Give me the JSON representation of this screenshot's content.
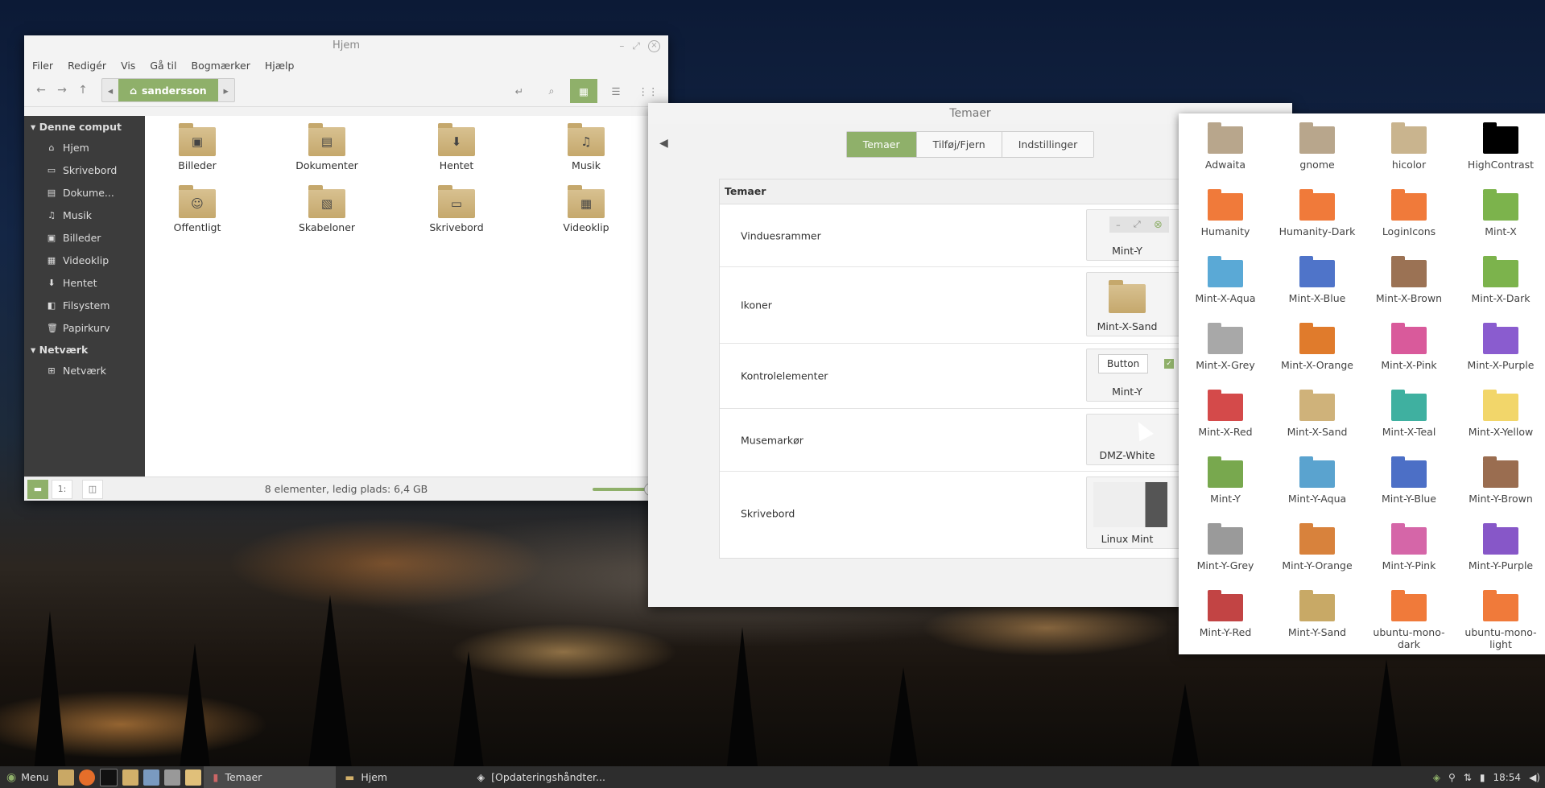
{
  "nemo": {
    "title": "Hjem",
    "menu": [
      "Filer",
      "Redigér",
      "Vis",
      "Gå til",
      "Bogmærker",
      "Hjælp"
    ],
    "breadcrumb": "sandersson",
    "sidebar": {
      "sections": [
        {
          "title": "Denne comput",
          "items": [
            {
              "label": "Hjem",
              "icon": "home-icon",
              "glyph": "⌂"
            },
            {
              "label": "Skrivebord",
              "icon": "desktop-icon",
              "glyph": "▭"
            },
            {
              "label": "Dokume...",
              "icon": "document-icon",
              "glyph": "▤"
            },
            {
              "label": "Musik",
              "icon": "music-icon",
              "glyph": "♫"
            },
            {
              "label": "Billeder",
              "icon": "pictures-icon",
              "glyph": "▣"
            },
            {
              "label": "Videoklip",
              "icon": "video-icon",
              "glyph": "▦"
            },
            {
              "label": "Hentet",
              "icon": "download-icon",
              "glyph": "⬇"
            },
            {
              "label": "Filsystem",
              "icon": "filesystem-icon",
              "glyph": "◧"
            },
            {
              "label": "Papirkurv",
              "icon": "trash-icon",
              "glyph": "🗑"
            }
          ]
        },
        {
          "title": "Netværk",
          "items": [
            {
              "label": "Netværk",
              "icon": "network-icon",
              "glyph": "⊞"
            }
          ]
        }
      ]
    },
    "files": [
      {
        "label": "Billeder",
        "glyph": "▣"
      },
      {
        "label": "Dokumenter",
        "glyph": "▤"
      },
      {
        "label": "Hentet",
        "glyph": "⬇"
      },
      {
        "label": "Musik",
        "glyph": "♫"
      },
      {
        "label": "Offentligt",
        "glyph": "☺"
      },
      {
        "label": "Skabeloner",
        "glyph": "▧"
      },
      {
        "label": "Skrivebord",
        "glyph": "▭"
      },
      {
        "label": "Videoklip",
        "glyph": "▦"
      }
    ],
    "status": "8 elementer, ledig plads: 6,4 GB",
    "status_btn2": "1:"
  },
  "themes": {
    "title": "Temaer",
    "tabs": [
      "Temaer",
      "Tilføj/Fjern",
      "Indstillinger"
    ],
    "panel_title": "Temaer",
    "rows": [
      {
        "label": "Vinduesrammer",
        "value": "Mint-Y"
      },
      {
        "label": "Ikoner",
        "value": "Mint-X-Sand"
      },
      {
        "label": "Kontrolelementer",
        "value": "Mint-Y",
        "button": "Button"
      },
      {
        "label": "Musemarkør",
        "value": "DMZ-White"
      },
      {
        "label": "Skrivebord",
        "value": "Linux Mint"
      }
    ]
  },
  "icon_themes": [
    {
      "name": "Adwaita",
      "color": "#b8a68c"
    },
    {
      "name": "gnome",
      "color": "#b8a68c"
    },
    {
      "name": "hicolor",
      "color": "#c9b48e"
    },
    {
      "name": "HighContrast",
      "color": "#000000"
    },
    {
      "name": "Humanity",
      "color": "#f07a3a"
    },
    {
      "name": "Humanity-Dark",
      "color": "#f07a3a"
    },
    {
      "name": "LoginIcons",
      "color": "#f07a3a"
    },
    {
      "name": "Mint-X",
      "color": "#7cb34c"
    },
    {
      "name": "Mint-X-Aqua",
      "color": "#5aa9d6"
    },
    {
      "name": "Mint-X-Blue",
      "color": "#4f74c9"
    },
    {
      "name": "Mint-X-Brown",
      "color": "#9b7254"
    },
    {
      "name": "Mint-X-Dark",
      "color": "#7cb34c"
    },
    {
      "name": "Mint-X-Grey",
      "color": "#a8a8a8"
    },
    {
      "name": "Mint-X-Orange",
      "color": "#e07b2c"
    },
    {
      "name": "Mint-X-Pink",
      "color": "#d95a9b"
    },
    {
      "name": "Mint-X-Purple",
      "color": "#8a5ccf"
    },
    {
      "name": "Mint-X-Red",
      "color": "#d44a4a"
    },
    {
      "name": "Mint-X-Sand",
      "color": "#cfb27a"
    },
    {
      "name": "Mint-X-Teal",
      "color": "#3fb0a0"
    },
    {
      "name": "Mint-X-Yellow",
      "color": "#f2d66a"
    },
    {
      "name": "Mint-Y",
      "color": "#78a84e"
    },
    {
      "name": "Mint-Y-Aqua",
      "color": "#5aa3cf"
    },
    {
      "name": "Mint-Y-Blue",
      "color": "#4c6fc6"
    },
    {
      "name": "Mint-Y-Brown",
      "color": "#9a6d50"
    },
    {
      "name": "Mint-Y-Grey",
      "color": "#9a9a9a"
    },
    {
      "name": "Mint-Y-Orange",
      "color": "#d8823c"
    },
    {
      "name": "Mint-Y-Pink",
      "color": "#d566a8"
    },
    {
      "name": "Mint-Y-Purple",
      "color": "#8757c8"
    },
    {
      "name": "Mint-Y-Red",
      "color": "#c24444"
    },
    {
      "name": "Mint-Y-Sand",
      "color": "#c8a966"
    },
    {
      "name": "ubuntu-mono-dark",
      "color": "#f07a3a"
    },
    {
      "name": "ubuntu-mono-light",
      "color": "#f07a3a"
    }
  ],
  "taskbar": {
    "menu_label": "Menu",
    "tasks": [
      "Temaer",
      "Hjem",
      "[Opdateringshåndter..."
    ],
    "clock": "18:54"
  },
  "colors": {
    "accent": "#8fb06a",
    "sidebar": "#3c3c3c",
    "taskbar": "#2d2d2d"
  }
}
